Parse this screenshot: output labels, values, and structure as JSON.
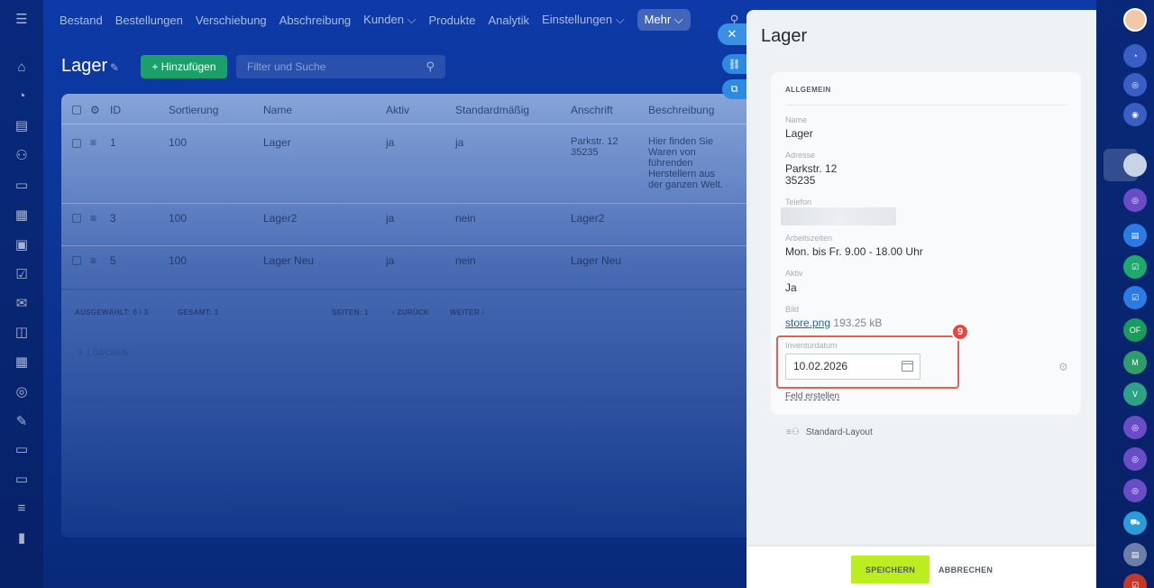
{
  "topnav": {
    "items": [
      "Bestand",
      "Bestellungen",
      "Verschiebung",
      "Abschreibung",
      "Kunden ⌵",
      "Produkte",
      "Analytik",
      "Einstellungen ⌵"
    ],
    "more": "Mehr ⌵",
    "menu_icon": "menu-icon",
    "search_icon": "search-icon"
  },
  "page": {
    "title": "Lager",
    "add_button": "+ Hinzufügen",
    "search_placeholder": "Filter und Suche"
  },
  "grid": {
    "columns": [
      "ID",
      "Sortierung",
      "Name",
      "Aktiv",
      "Standardmäßig",
      "Anschrift",
      "Beschreibung"
    ],
    "rows": [
      {
        "id": "1",
        "sort": "100",
        "name": "Lager",
        "active": "ja",
        "default": "ja",
        "address1": "Parkstr. 12",
        "address2": "35235",
        "description": "Hier finden Sie Waren von führenden Herstellern aus der ganzen Welt."
      },
      {
        "id": "3",
        "sort": "100",
        "name": "Lager2",
        "active": "ja",
        "default": "nein",
        "address1": "Lager2",
        "address2": "",
        "description": ""
      },
      {
        "id": "5",
        "sort": "100",
        "name": "Lager Neu",
        "active": "ja",
        "default": "nein",
        "address1": "Lager Neu",
        "address2": "",
        "description": ""
      }
    ],
    "footer": {
      "selected": "AUSGEWÄHLT: 0 / 3",
      "total": "GESAMT: 3",
      "pages": "SEITEN: 1",
      "back": "‹ ZURÜCK",
      "next": "WEITER ›"
    },
    "delete": "✕ LÖSCHEN"
  },
  "slider": {
    "title": "Lager",
    "section": "ALLGEMEIN",
    "fields": {
      "name_label": "Name",
      "name_value": "Lager",
      "address_label": "Adresse",
      "address_line1": "Parkstr. 12",
      "address_line2": "35235",
      "phone_label": "Telefon",
      "hours_label": "Arbeitszeiten",
      "hours_value": "Mon. bis Fr. 9.00 - 18.00 Uhr",
      "active_label": "Aktiv",
      "active_value": "Ja",
      "image_label": "Bild",
      "image_file": "store.png",
      "image_size": "193.25 kB",
      "inventory_label": "Inventurdatum",
      "inventory_value": "10.02.2026"
    },
    "create_field": "Feld erstellen",
    "layout": "Standard-Layout",
    "badge": "9",
    "save": "SPEICHERN",
    "cancel": "ABBRECHEN"
  },
  "right_rail": {
    "labels": [
      "OF",
      "M",
      "V"
    ]
  },
  "colors": {
    "accent_green": "#1aa06a",
    "save_green": "#bbed21",
    "highlight_red": "#e35e55",
    "link_blue": "#2067b0"
  }
}
